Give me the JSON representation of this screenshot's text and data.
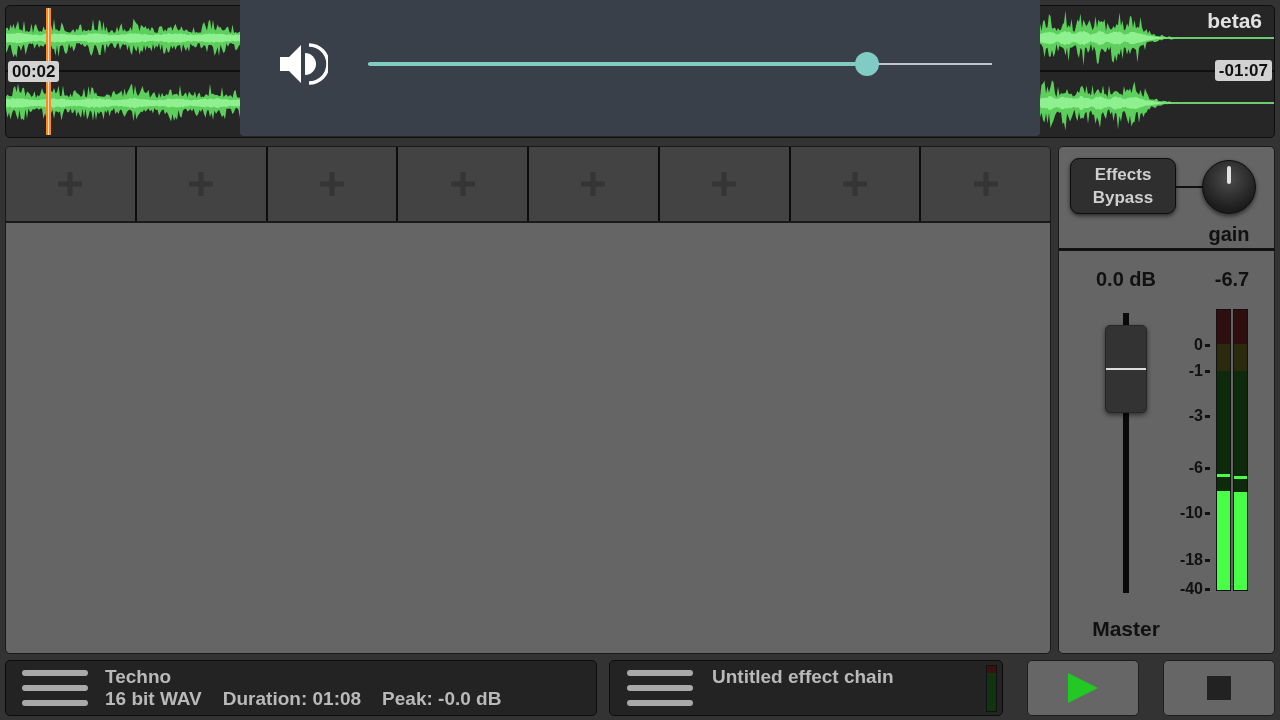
{
  "waveform": {
    "title": "beta6",
    "elapsed": "00:02",
    "remaining": "-01:07",
    "playhead": {
      "level": 0.033
    }
  },
  "volume_popup": {
    "level": 0.8
  },
  "effect_slots": [
    {
      "kind": "empty"
    },
    {
      "kind": "empty"
    },
    {
      "kind": "empty"
    },
    {
      "kind": "empty"
    },
    {
      "kind": "empty"
    },
    {
      "kind": "empty"
    },
    {
      "kind": "empty"
    },
    {
      "kind": "empty"
    }
  ],
  "master": {
    "bypass_button": "Effects Bypass",
    "gain_knob": {
      "label": "gain",
      "level": 0.5
    },
    "fader": {
      "reading": "0.0 dB",
      "level": 0.8
    },
    "meter": {
      "reading": "-6.7",
      "scale": [
        "0",
        "-1",
        "-3",
        "-6",
        "-10",
        "-18",
        "-40"
      ],
      "channels": [
        {
          "level": 0.355,
          "peak_hold": {
            "level": 0.404
          }
        },
        {
          "level": 0.35,
          "peak_hold": {
            "level": 0.397
          }
        }
      ]
    },
    "label": "Master"
  },
  "file_info": {
    "name": "Techno",
    "format": "16 bit WAV",
    "duration": "Duration: 01:08",
    "peak": "Peak: -0.0 dB"
  },
  "effect_chain": {
    "name": "Untitled effect chain",
    "meter": {
      "level": 0
    }
  },
  "transport": [
    {
      "kind": "play"
    },
    {
      "kind": "stop"
    }
  ]
}
